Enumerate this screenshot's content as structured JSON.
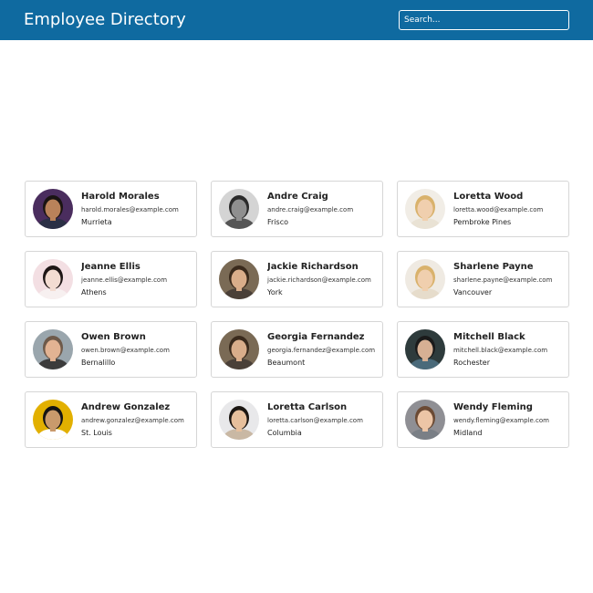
{
  "header": {
    "title": "Employee Directory",
    "search_placeholder": "Search..."
  },
  "employees": [
    {
      "name": "Harold Morales",
      "email": "harold.morales@example.com",
      "city": "Murrieta",
      "avatar": {
        "bg": "#4a2d5e",
        "skin": "#b9825a",
        "hair": "#1a1412",
        "shirt": "#2a2f45"
      }
    },
    {
      "name": "Andre Craig",
      "email": "andre.craig@example.com",
      "city": "Frisco",
      "avatar": {
        "bg": "#d4d4d4",
        "skin": "#8f8f8f",
        "hair": "#2b2b2b",
        "shirt": "#555555"
      }
    },
    {
      "name": "Loretta Wood",
      "email": "loretta.wood@example.com",
      "city": "Pembroke Pines",
      "avatar": {
        "bg": "#f1ede6",
        "skin": "#f0cfae",
        "hair": "#d9b26c",
        "shirt": "#e9e2d4"
      }
    },
    {
      "name": "Jeanne Ellis",
      "email": "jeanne.ellis@example.com",
      "city": "Athens",
      "avatar": {
        "bg": "#f3dfe3",
        "skin": "#f3dcd2",
        "hair": "#1e1616",
        "shirt": "#f7f0f0"
      }
    },
    {
      "name": "Jackie Richardson",
      "email": "jackie.richardson@example.com",
      "city": "York",
      "avatar": {
        "bg": "#7a6a55",
        "skin": "#d9ad8a",
        "hair": "#3a2a1c",
        "shirt": "#4a4038"
      }
    },
    {
      "name": "Sharlene Payne",
      "email": "sharlene.payne@example.com",
      "city": "Vancouver",
      "avatar": {
        "bg": "#efeae2",
        "skin": "#f0cfae",
        "hair": "#d9b26c",
        "shirt": "#e6dccb"
      }
    },
    {
      "name": "Owen Brown",
      "email": "owen.brown@example.com",
      "city": "Bernalillo",
      "avatar": {
        "bg": "#9aa6ad",
        "skin": "#e2b393",
        "hair": "#6e5a4a",
        "shirt": "#3c3c3c"
      }
    },
    {
      "name": "Georgia Fernandez",
      "email": "georgia.fernandez@example.com",
      "city": "Beaumont",
      "avatar": {
        "bg": "#7a6a55",
        "skin": "#d9ad8a",
        "hair": "#3a2a1c",
        "shirt": "#4a4038"
      }
    },
    {
      "name": "Mitchell Black",
      "email": "mitchell.black@example.com",
      "city": "Rochester",
      "avatar": {
        "bg": "#2e3b3c",
        "skin": "#d6b094",
        "hair": "#1a1a1a",
        "shirt": "#4a6a7a"
      }
    },
    {
      "name": "Andrew Gonzalez",
      "email": "andrew.gonzalez@example.com",
      "city": "St. Louis",
      "avatar": {
        "bg": "#e2b000",
        "skin": "#c99a6c",
        "hair": "#141414",
        "shirt": "#ffffff"
      }
    },
    {
      "name": "Loretta Carlson",
      "email": "loretta.carlson@example.com",
      "city": "Columbia",
      "avatar": {
        "bg": "#e8e8ea",
        "skin": "#e6bf9c",
        "hair": "#1b1612",
        "shirt": "#c9b8a4"
      }
    },
    {
      "name": "Wendy Fleming",
      "email": "wendy.fleming@example.com",
      "city": "Midland",
      "avatar": {
        "bg": "#8f8f94",
        "skin": "#ecc5a6",
        "hair": "#6b4a34",
        "shirt": "#7a7f86"
      }
    }
  ]
}
